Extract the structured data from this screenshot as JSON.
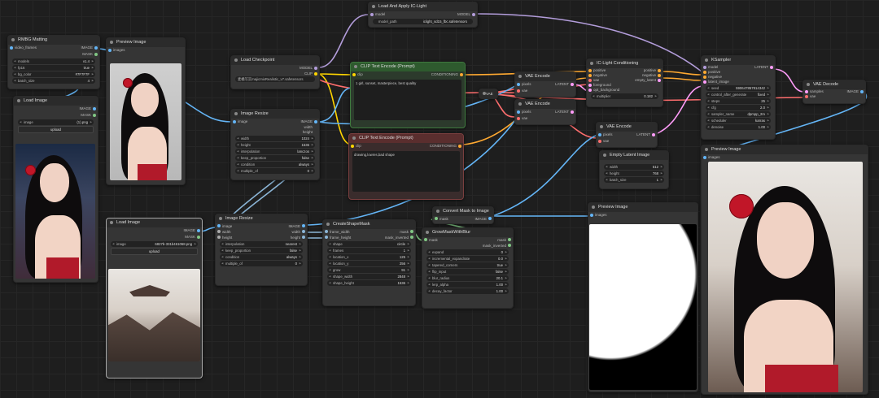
{
  "nodes": {
    "rmbg": {
      "title": "RMBG Matting",
      "out1": "IMAGE",
      "out2": "MASK",
      "in1": "video_frames",
      "w1k": "models",
      "w1v": "v1.4",
      "w2k": "fp16",
      "w2v": "true",
      "w3k": "bg_color",
      "w3v": "#7F7F7F",
      "w4k": "batch_size",
      "w4v": "4"
    },
    "preview1": {
      "title": "Preview Image",
      "in1": "images"
    },
    "load_image1": {
      "title": "Load Image",
      "out1": "IMAGE",
      "out2": "MASK",
      "w1k": "image",
      "w1v": "(1).png",
      "btn": "upload"
    },
    "load_ckpt": {
      "title": "Load Checkpoint",
      "out1": "MODEL",
      "out2": "CLIP",
      "out3": "VAE",
      "w1k": "ckpt_name",
      "w1v": "麦橘写实majicmixRealistic_v7.safetensors"
    },
    "img_resize1": {
      "title": "Image Resize",
      "in1": "image",
      "out1": "IMAGE",
      "out2": "width",
      "out3": "height",
      "w1k": "width",
      "w1v": "1024",
      "w2k": "height",
      "w2v": "1536",
      "w3k": "interpolation",
      "w3v": "lanczos",
      "w4k": "keep_proportion",
      "w4v": "false",
      "w5k": "condition",
      "w5v": "always",
      "w6k": "multiple_of",
      "w6v": "0"
    },
    "load_apply_ic": {
      "title": "Load And Apply IC-Light",
      "in1": "model",
      "out1": "MODEL",
      "w1k": "model_path",
      "w1v": "iclight_sd15_fbc.safetensors"
    },
    "clip_pos": {
      "title": "CLIP Text Encode (Prompt)",
      "in1": "clip",
      "out1": "CONDITIONING",
      "text": "1 girl, sunset, masterpiece, best quality"
    },
    "clip_neg": {
      "title": "CLIP Text Encode (Prompt)",
      "in1": "clip",
      "out1": "CONDITIONING",
      "text": "drawing,lowres,bad shape"
    },
    "vae_dec_center": {
      "title": "VAE"
    },
    "vae_enc1": {
      "title": "VAE Encode",
      "in1": "pixels",
      "in2": "vae",
      "out1": "LATENT"
    },
    "vae_enc2": {
      "title": "VAE Encode",
      "in1": "pixels",
      "in2": "vae",
      "out1": "LATENT"
    },
    "ic_cond": {
      "title": "IC-Light Conditioning",
      "in1": "positive",
      "in2": "negative",
      "in3": "vae",
      "in4": "foreground",
      "in5": "opt_background",
      "out1": "positive",
      "out2": "negative",
      "out3": "empty_latent",
      "w1k": "multiplier",
      "w1v": "0.182"
    },
    "vae_enc3": {
      "title": "VAE Encode",
      "in1": "pixels",
      "in2": "vae",
      "out1": "LATENT"
    },
    "empty_latent": {
      "title": "Empty Latent Image",
      "w1k": "width",
      "w1v": "512",
      "w2k": "height",
      "w2v": "768",
      "w3k": "batch_size",
      "w3v": "1"
    },
    "ksampler": {
      "title": "KSampler",
      "in1": "model",
      "in2": "positive",
      "in3": "negative",
      "in4": "latent_image",
      "out1": "LATENT",
      "w1k": "seed",
      "w1v": "590647857814342",
      "w2k": "control_after_generate",
      "w2v": "fixed",
      "w3k": "steps",
      "w3v": "25",
      "w4k": "cfg",
      "w4v": "2.0",
      "w5k": "sampler_name",
      "w5v": "dpmpp_2m",
      "w6k": "scheduler",
      "w6v": "karras",
      "w7k": "denoise",
      "w7v": "1.00"
    },
    "vae_decode": {
      "title": "VAE Decode",
      "in1": "samples",
      "in2": "vae",
      "out1": "IMAGE"
    },
    "preview_final": {
      "title": "Preview Image",
      "in1": "images"
    },
    "load_image2": {
      "title": "Load Image",
      "out1": "IMAGE",
      "out2": "MASK",
      "w1k": "image",
      "w1v": "6827b-331b461068.png",
      "btn": "upload"
    },
    "img_resize2": {
      "title": "Image Resize",
      "in1": "image",
      "in2": "width",
      "in3": "height",
      "out1": "IMAGE",
      "out2": "width",
      "out3": "height",
      "w1k": "interpolation",
      "w1v": "nearest",
      "w2k": "keep_proportion",
      "w2v": "false",
      "w3k": "condition",
      "w3v": "always",
      "w4k": "multiple_of",
      "w4v": "0"
    },
    "create_shape": {
      "title": "CreateShapeMask",
      "in1": "frame_width",
      "in2": "frame_height",
      "out1": "mask",
      "out2": "mask_inverted",
      "w1k": "shape",
      "w1v": "circle",
      "w2k": "frames",
      "w2v": "1",
      "w3k": "location_x",
      "w3v": "125",
      "w4k": "location_y",
      "w4v": "256",
      "w5k": "grow",
      "w5v": "91",
      "w6k": "shape_width",
      "w6v": "2848",
      "w7k": "shape_height",
      "w7v": "1536"
    },
    "convert_mask": {
      "title": "Convert Mask to Image",
      "in1": "mask",
      "out1": "IMAGE"
    },
    "grow_mask": {
      "title": "GrowMaskWithBlur",
      "in1": "mask",
      "out1": "mask",
      "out2": "mask_inverted",
      "w1k": "expand",
      "w1v": "0",
      "w2k": "incremental_expandrate",
      "w2v": "0.0",
      "w3k": "tapered_corners",
      "w3v": "true",
      "w4k": "flip_input",
      "w4v": "false",
      "w5k": "blur_radius",
      "w5v": "20.1",
      "w6k": "lerp_alpha",
      "w6v": "1.00",
      "w7k": "decay_factor",
      "w7v": "1.00"
    },
    "preview_mask": {
      "title": "Preview Image",
      "in1": "images"
    }
  },
  "colors": {
    "clip": "#ffd500",
    "model": "#b39ddb",
    "vae": "#ff6e6e",
    "image": "#64b5f6",
    "latent": "#ff9cf9",
    "cond": "#ffa931",
    "mask": "#81c784",
    "int": "#aaaaaa"
  }
}
